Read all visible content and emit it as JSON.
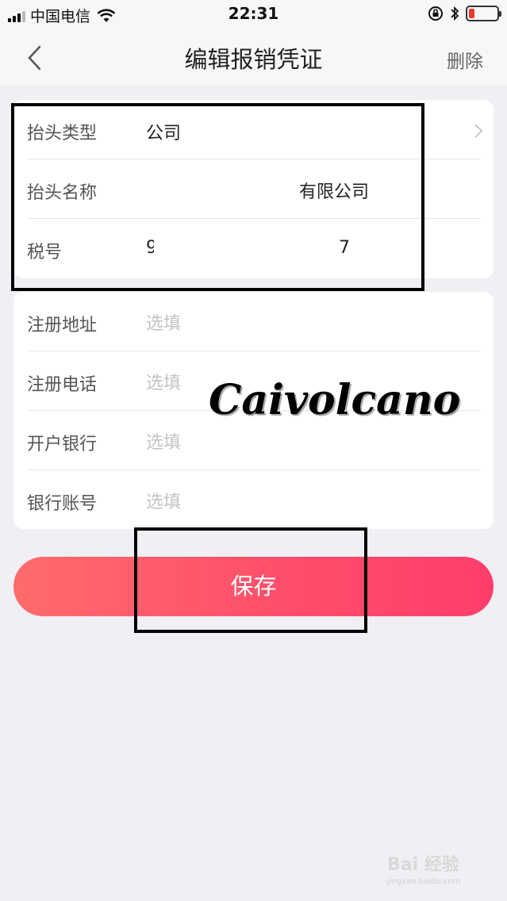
{
  "status_bar": {
    "carrier": "中国电信",
    "time": "22:31"
  },
  "nav": {
    "title": "编辑报销凭证",
    "delete_label": "删除"
  },
  "invoice_header": {
    "type_label": "抬头类型",
    "type_value": "公司",
    "name_label": "抬头名称",
    "name_value": "有限公司",
    "tax_label": "税号",
    "tax_value_start": "9",
    "tax_value_end": "7"
  },
  "optional_fields": [
    {
      "label": "注册地址",
      "placeholder": "选填"
    },
    {
      "label": "注册电话",
      "placeholder": "选填"
    },
    {
      "label": "开户银行",
      "placeholder": "选填"
    },
    {
      "label": "银行账号",
      "placeholder": "选填"
    }
  ],
  "save_label": "保存",
  "watermark_text": "Caivolcano",
  "baidu_watermark": {
    "brand": "Bai 经验",
    "url": "jingyan.baidu.com"
  }
}
